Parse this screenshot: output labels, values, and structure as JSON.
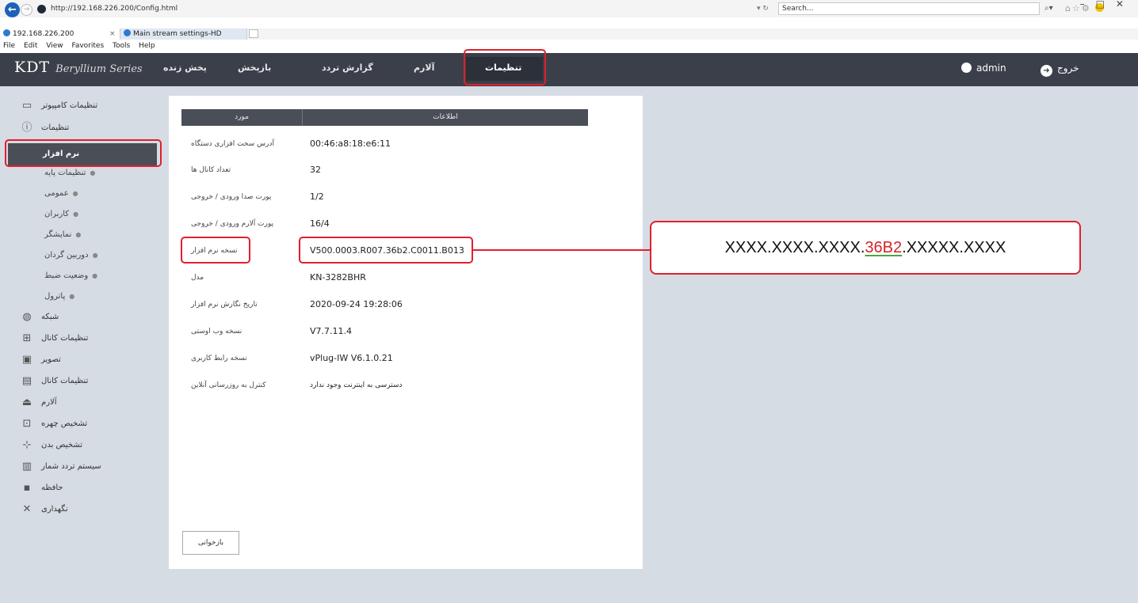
{
  "browser": {
    "url": "http://192.168.226.200/Config.html",
    "search_placeholder": "Search...",
    "addr_tools": "▾ ↻",
    "search_glyph": "⌕▾",
    "tool_icons": "⌂☆⚙",
    "window_controls": "–□✕",
    "tabs": [
      {
        "label": "192.168.226.200",
        "close": "×"
      },
      {
        "label": "Main stream settings-HD Enco..."
      }
    ],
    "menu": [
      "File",
      "Edit",
      "View",
      "Favorites",
      "Tools",
      "Help"
    ]
  },
  "header": {
    "logo": "KDT",
    "logo_series": "Beryllium Series",
    "nav": [
      "پخش زنده",
      "بازپخش",
      "گزارش تردد",
      "آلارم",
      "تنظیمات"
    ],
    "active_nav": "تنظیمات",
    "user": "admin",
    "logout": "خروج"
  },
  "sidebar": {
    "items": [
      {
        "label": "تنظیمات کامپیوتر",
        "icon": "monitor-icon"
      },
      {
        "label": "تنظیمات",
        "icon": "info-icon"
      }
    ],
    "selected": "نرم افزار",
    "subitems": [
      "تنظیمات پایه",
      "عمومی",
      "کاربران",
      "نمایشگر",
      "دوربین گردان",
      "وضعیت ضبط",
      "پاترول"
    ],
    "sections": [
      {
        "label": "شبکه",
        "icon": "globe-icon"
      },
      {
        "label": "تنظیمات کانال",
        "icon": "network-icon"
      },
      {
        "label": "تصویر",
        "icon": "image-icon"
      },
      {
        "label": "تنظیمات کانال",
        "icon": "display-icon"
      },
      {
        "label": "آلارم",
        "icon": "alarm-icon"
      },
      {
        "label": "تشخیص چهره",
        "icon": "face-icon"
      },
      {
        "label": "تشخیص بدن",
        "icon": "body-icon"
      },
      {
        "label": "سیستم تردد شمار",
        "icon": "chart-icon"
      },
      {
        "label": "حافظه",
        "icon": "save-icon"
      },
      {
        "label": "نگهداری",
        "icon": "tools-icon"
      }
    ]
  },
  "table": {
    "col_item": "مورد",
    "col_info": "اطلاعات",
    "rows": [
      {
        "key": "آدرس سخت افزاری دستگاه",
        "value": "00:46:a8:18:e6:11"
      },
      {
        "key": "تعداد کانال ها",
        "value": "32"
      },
      {
        "key": "پورت صدا ورودی / خروجی",
        "value": "1/2"
      },
      {
        "key": "پورت آلارم ورودی / خروجی",
        "value": "16/4"
      },
      {
        "key": "نسخه نرم افزار",
        "value": "V500.0003.R007.36b2.C0011.B013"
      },
      {
        "key": "مدل",
        "value": "KN-3282BHR"
      },
      {
        "key": "تاریخ نگارش نرم افزار",
        "value": "2020-09-24 19:28:06"
      },
      {
        "key": "نسخه وب اوستی",
        "value": "V7.7.11.4"
      },
      {
        "key": "نسخه رابط کاربری",
        "value": "vPlug-IW V6.1.0.21"
      },
      {
        "key": "کنترل به روزرسانی آنلاین",
        "value": "دسترسی به اینترنت وجود ندارد"
      }
    ]
  },
  "reload_button": "بازخوانی",
  "callout": {
    "prefix": "XXXX.XXXX.XXXX.",
    "highlight": "36B2",
    "suffix": ".XXXXX.XXXX"
  }
}
